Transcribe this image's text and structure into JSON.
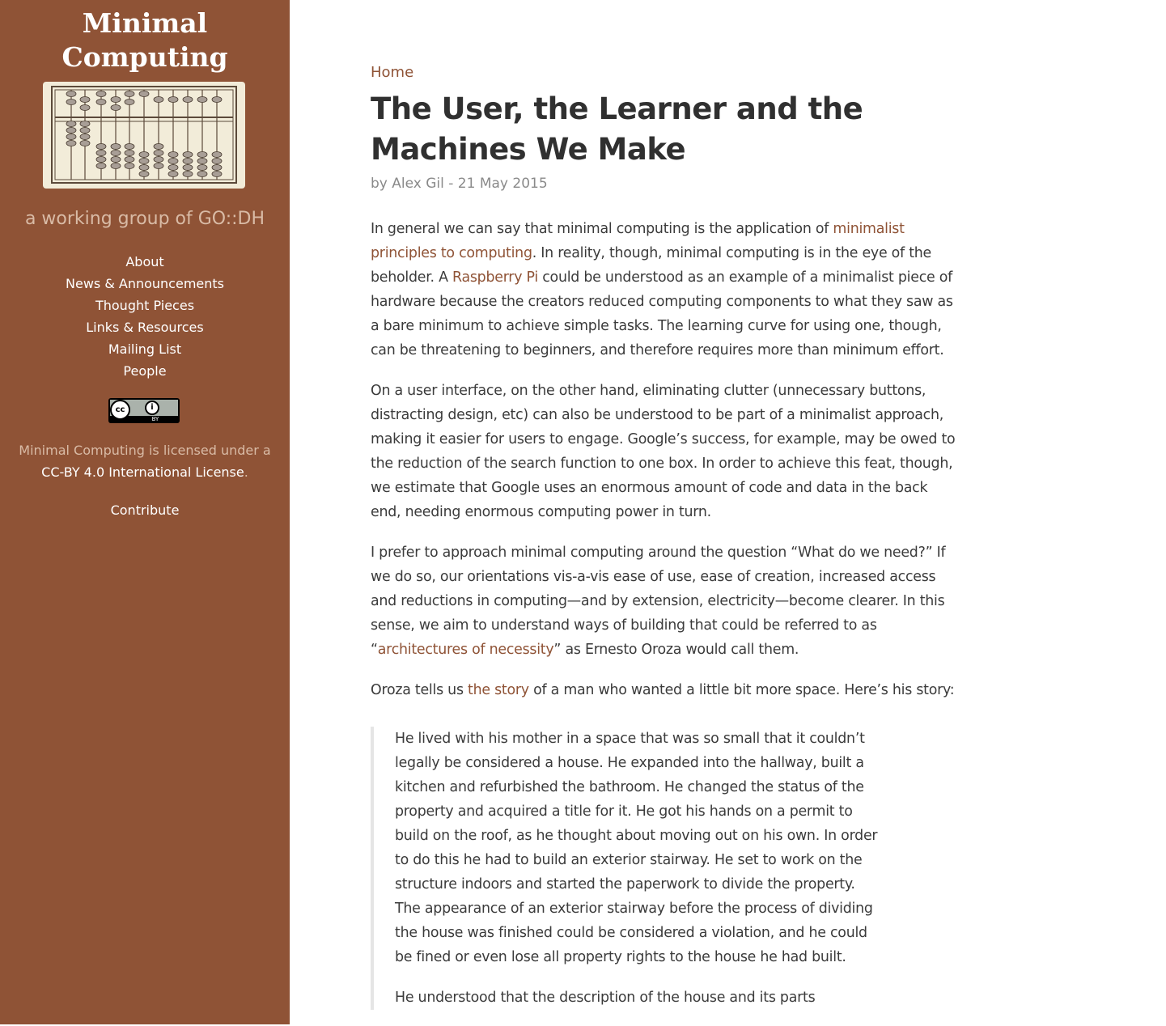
{
  "sidebar": {
    "site_title_line1": "Minimal",
    "site_title_line2": "Computing",
    "logo": "abacus-logo",
    "tagline": "a working group of GO::DH",
    "nav": [
      "About",
      "News & Announcements",
      "Thought Pieces",
      "Links & Resources",
      "Mailing List",
      "People"
    ],
    "cc_badge": {
      "cc": "cc",
      "by": "BY",
      "icon": "cc-by-icon"
    },
    "license_prefix": "Minimal Computing is licensed under a",
    "license_link": "CC-BY 4.0 International License",
    "license_suffix": ".",
    "contribute": "Contribute"
  },
  "article": {
    "breadcrumb": "Home",
    "title": "The User, the Learner and the Machines We Make",
    "byline": "by Alex Gil - 21 May 2015",
    "p1": {
      "t1": "In general we can say that minimal computing is the application of ",
      "l1": "minimalist principles to computing",
      "t2": ". In reality, though, minimal computing is in the eye of the beholder. A ",
      "l2": "Raspberry Pi",
      "t3": " could be understood as an example of a minimalist piece of hardware because the creators reduced computing components to what they saw as a bare minimum to achieve simple tasks. The learning curve for using one, though, can be threatening to beginners, and therefore requires more than minimum effort."
    },
    "p2": "On a user interface, on the other hand, eliminating clutter (unnecessary buttons, distracting design, etc) can also be understood to be part of a minimalist approach, making it easier for users to engage. Google’s success, for example, may be owed to the reduction of the search function to one box. In order to achieve this feat, though, we estimate that Google uses an enormous amount of code and data in the back end, needing enormous computing power in turn.",
    "p3": {
      "t1": "I prefer to approach minimal computing around the question “What do we need?” If we do so, our orientations vis-a-vis ease of use, ease of creation, increased access and reductions in computing—and by extension, electricity—become clearer. In this sense, we aim to understand ways of building that could be referred to as “",
      "l1": "architectures of necessity",
      "t2": "” as Ernesto Oroza would call them."
    },
    "p4": {
      "t1": "Oroza tells us ",
      "l1": "the story",
      "t2": " of a man who wanted a little bit more space. Here’s his story:"
    },
    "quote": [
      "He lived with his mother in a space that was so small that it couldn’t legally be considered a house. He expanded into the hallway, built a kitchen and refurbished the bathroom. He changed the status of the property and acquired a title for it. He got his hands on a permit to build on the roof, as he thought about moving out on his own. In order to do this he had to build an exterior stairway. He set to work on the structure indoors and started the paperwork to divide the property. The appearance of an exterior stairway before the process of dividing the house was finished could be considered a violation, and he could be fined or even lose all property rights to the house he had built.",
      "He understood that the description of the house and its parts"
    ]
  }
}
